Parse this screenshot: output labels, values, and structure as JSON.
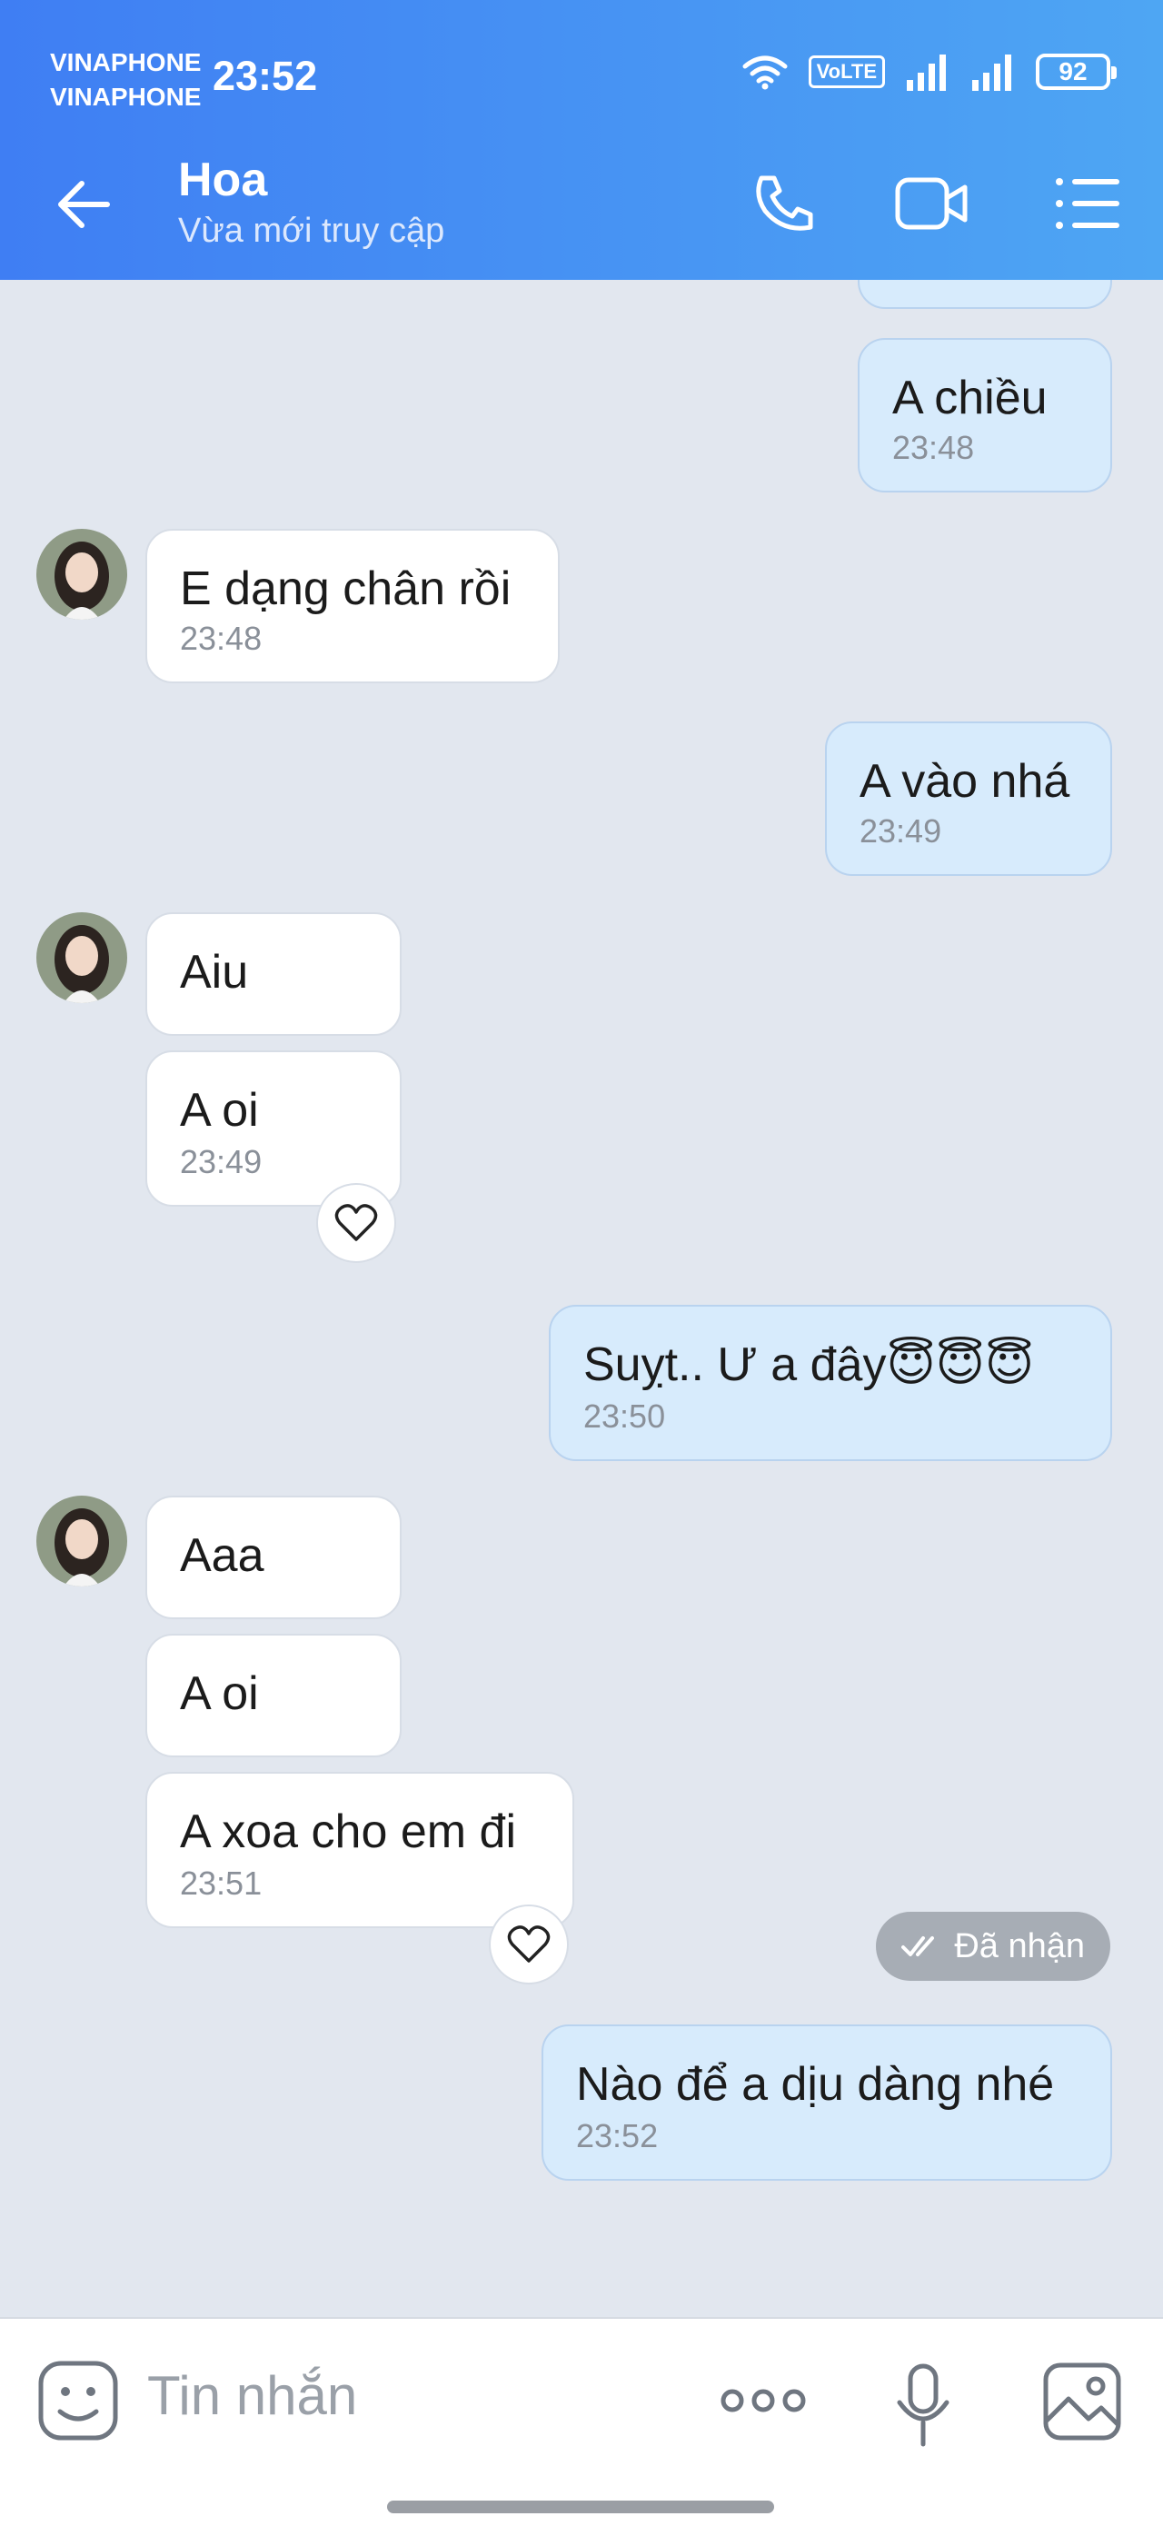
{
  "status_bar": {
    "carrier1": "VINAPHONE",
    "carrier2": "VINAPHONE",
    "time": "23:52",
    "volte": "VoLTE",
    "battery": "92"
  },
  "header": {
    "name": "Hoa",
    "status": "Vừa mới truy cập"
  },
  "messages": [
    {
      "text": "A chiều",
      "time": "23:48"
    },
    {
      "text": "E dạng chân rồi",
      "time": "23:48"
    },
    {
      "text": "A vào nhá",
      "time": "23:49"
    },
    {
      "text": "Aiu"
    },
    {
      "text": "A oi",
      "time": "23:49"
    },
    {
      "text": "Suỵt.. Ư a đây😇😇😇",
      "time": "23:50"
    },
    {
      "text": "Aaa"
    },
    {
      "text": "A oi"
    },
    {
      "text": "A xoa cho em đi",
      "time": "23:51"
    },
    {
      "text": "Nào để a dịu dàng nhé",
      "time": "23:52"
    }
  ],
  "read_receipt": "Đã nhận",
  "composer": {
    "placeholder": "Tin nhắn"
  },
  "colors": {
    "header_start": "#3f7ef3",
    "header_end": "#4ea6f3",
    "chat_bg": "#e2e7ef",
    "outgoing_bubble": "#d7ebfc",
    "incoming_bubble": "#ffffff"
  }
}
